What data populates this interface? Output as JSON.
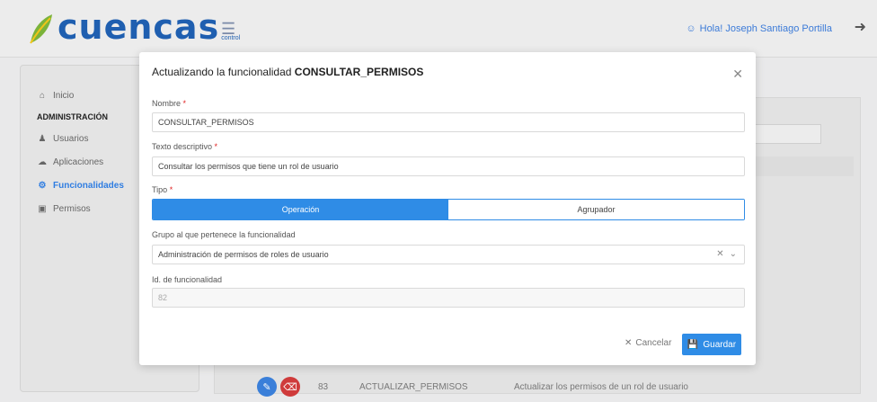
{
  "header": {
    "logo_text": "cuencas",
    "logo_sub": "control",
    "menu_icon": "hamburger-icon",
    "user_label": "Hola! Joseph Santiago Portilla",
    "logout_icon": "logout-icon"
  },
  "sidebar": {
    "items": [
      {
        "label": "Inicio",
        "icon": "home-icon"
      },
      {
        "heading": "ADMINISTRACIÓN"
      },
      {
        "label": "Usuarios",
        "icon": "users-icon"
      },
      {
        "label": "Aplicaciones",
        "icon": "cloud-icon"
      },
      {
        "label": "Funcionalidades",
        "icon": "settings-icon",
        "active": true
      },
      {
        "label": "Permisos",
        "icon": "lock-icon"
      }
    ]
  },
  "background_row": {
    "id": "83",
    "name": "ACTUALIZAR_PERMISOS",
    "description": "Actualizar los permisos de un rol de usuario"
  },
  "modal": {
    "title_prefix": "Actualizando la funcionalidad",
    "title_name": "CONSULTAR_PERMISOS",
    "fields": {
      "nombre_label": "Nombre",
      "nombre_value": "CONSULTAR_PERMISOS",
      "texto_label": "Texto descriptivo",
      "texto_value": "Consultar los permisos que tiene un rol de usuario",
      "tipo_label": "Tipo",
      "tipo_options": [
        "Operación",
        "Agrupador"
      ],
      "tipo_selected": "Operación",
      "grupo_label": "Grupo al que pertenece la funcionalidad",
      "grupo_value": "Administración de permisos de roles de usuario",
      "id_label": "Id. de funcionalidad",
      "id_value": "82"
    },
    "required_mark": "*",
    "cancel_label": "Cancelar",
    "save_label": "Guardar"
  },
  "colors": {
    "accent": "#2f8ce6",
    "brand": "#1f5fb0",
    "required": "#e02424",
    "delete": "#cf3b3b"
  }
}
